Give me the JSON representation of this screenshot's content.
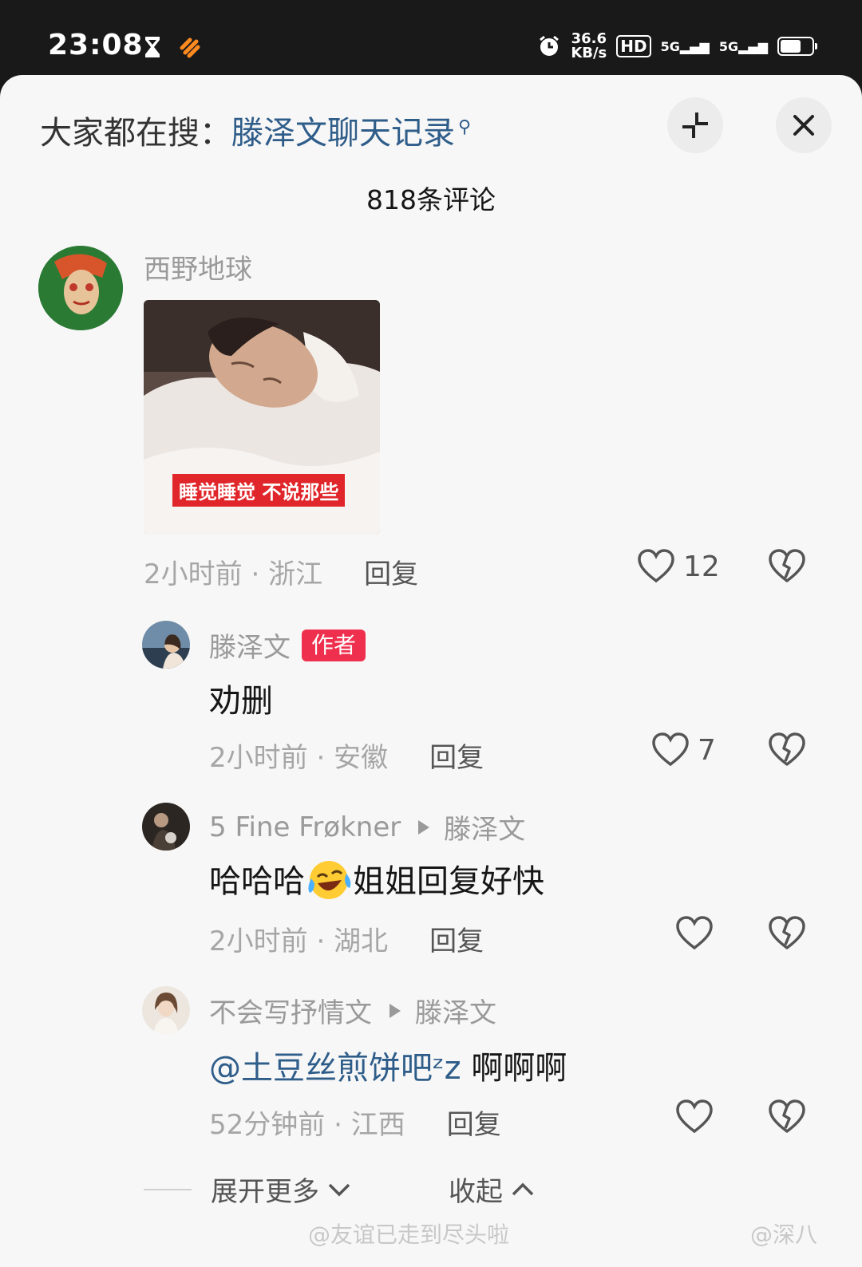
{
  "status_bar": {
    "time": "23:08",
    "speed_value": "36.6",
    "speed_unit": "KB/s",
    "hd": "HD",
    "sim1": "5G",
    "sim2": "5G"
  },
  "search_hint": {
    "prefix": "大家都在搜：",
    "query": "滕泽文聊天记录"
  },
  "comment_count": "818条评论",
  "comments": [
    {
      "user": "西野地球",
      "image_caption": "睡觉睡觉 不说那些",
      "time": "2小时前",
      "location": "浙江",
      "reply": "回复",
      "likes": "12"
    },
    {
      "user": "滕泽文",
      "tag": "作者",
      "text": "劝删",
      "time": "2小时前",
      "location": "安徽",
      "reply": "回复",
      "likes": "7"
    },
    {
      "user": "5 Fine Frøkner",
      "reply_to": "滕泽文",
      "text_before": "哈哈哈",
      "emoji": "laughing-crying-emoji",
      "text_after": "姐姐回复好快",
      "time": "2小时前",
      "location": "湖北",
      "reply": "回复"
    },
    {
      "user": "不会写抒情文",
      "reply_to": "滕泽文",
      "mention": "@土豆丝煎饼吧ᶻz",
      "text": " 啊啊啊",
      "time": "52分钟前",
      "location": "江西",
      "reply": "回复"
    }
  ],
  "footer": {
    "expand": "展开更多",
    "collapse": "收起",
    "watermark_left": "@友谊已走到尽头啦",
    "watermark_right": "@深八"
  },
  "colors": {
    "mention": "#2f5d8a",
    "author_tag": "#ef2f4e",
    "caption_bg": "#e0262a"
  }
}
